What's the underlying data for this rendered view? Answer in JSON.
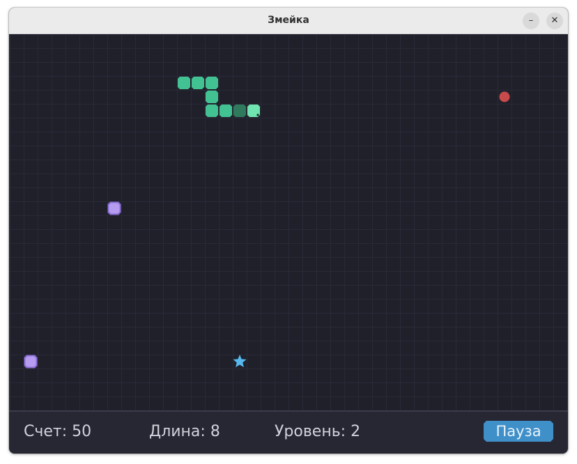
{
  "window": {
    "title": "Змейка",
    "controls": {
      "minimize_glyph": "–",
      "close_glyph": "✕"
    }
  },
  "game": {
    "grid": {
      "cols": 40,
      "rows": 27
    },
    "colors": {
      "background": "#20202b",
      "grid_line": "#2a2a37",
      "snake_head": "#6fe3b0",
      "snake_body": "#42c292",
      "snake_body_dark": "#2f7a5c",
      "food_red": "#c84a4a",
      "bonus_purple": "#b59cf0",
      "bonus_purple_edge": "#8b6fd6",
      "star_blue": "#56b8ec"
    },
    "snake": [
      {
        "col": 17,
        "row": 5,
        "part": "head"
      },
      {
        "col": 16,
        "row": 5,
        "part": "body-dark"
      },
      {
        "col": 15,
        "row": 5,
        "part": "body"
      },
      {
        "col": 14,
        "row": 5,
        "part": "body"
      },
      {
        "col": 14,
        "row": 4,
        "part": "body"
      },
      {
        "col": 14,
        "row": 3,
        "part": "body"
      },
      {
        "col": 13,
        "row": 3,
        "part": "body"
      },
      {
        "col": 12,
        "row": 3,
        "part": "body"
      }
    ],
    "items": [
      {
        "type": "food-red",
        "icon": "apple-icon",
        "col": 35,
        "row": 4
      },
      {
        "type": "bonus-purple",
        "icon": "gem-icon",
        "col": 7,
        "row": 12
      },
      {
        "type": "bonus-purple",
        "icon": "gem-icon",
        "col": 1,
        "row": 23
      },
      {
        "type": "star-blue",
        "icon": "star-icon",
        "col": 16,
        "row": 23
      }
    ]
  },
  "status": {
    "score": "Счет: 50",
    "length": "Длина: 8",
    "level": "Уровень: 2",
    "pause_label": "Пауза"
  }
}
